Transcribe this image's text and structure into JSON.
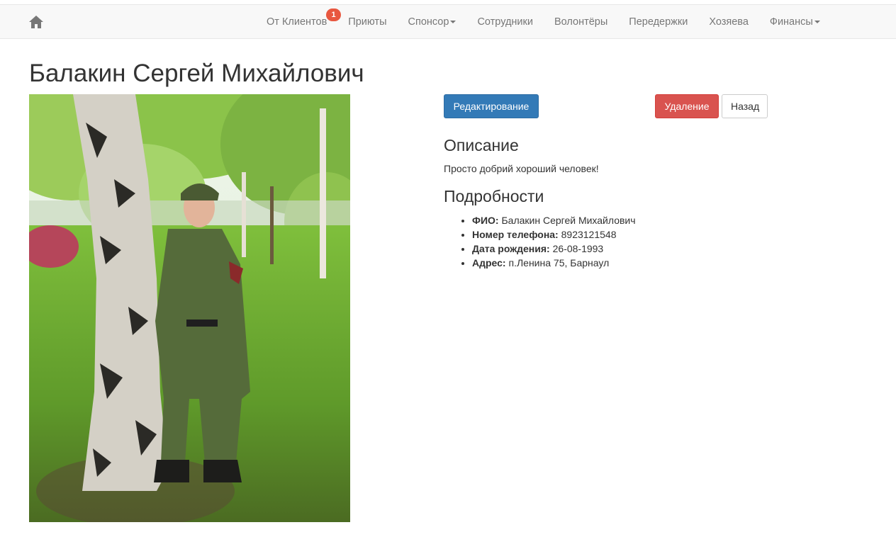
{
  "nav": {
    "home_icon": "home-icon",
    "items": [
      {
        "label": "От Клиентов",
        "badge": "1"
      },
      {
        "label": "Приюты"
      },
      {
        "label": "Спонсор",
        "dropdown": true
      },
      {
        "label": "Сотрудники"
      },
      {
        "label": "Волонтёры"
      },
      {
        "label": "Передержки"
      },
      {
        "label": "Хозяева"
      },
      {
        "label": "Финансы",
        "dropdown": true
      }
    ]
  },
  "page": {
    "title": "Балакин Сергей Михайлович"
  },
  "actions": {
    "edit_label": "Редактирование",
    "delete_label": "Удаление",
    "back_label": "Назад"
  },
  "description": {
    "heading": "Описание",
    "text": "Просто добрий хороший человек!"
  },
  "details": {
    "heading": "Подробности",
    "items": [
      {
        "label": "ФИО:",
        "value": "Балакин Сергей Михайлович"
      },
      {
        "label": "Номер телефона:",
        "value": "8923121548"
      },
      {
        "label": "Дата рождения:",
        "value": "26-08-1993"
      },
      {
        "label": "Адрес:",
        "value": "п.Ленина 75, Барнаул"
      }
    ]
  },
  "colors": {
    "primary": "#337ab7",
    "danger": "#d9534f",
    "badge": "#e8573f",
    "navbar_bg": "#f8f8f8",
    "nav_text": "#777777"
  }
}
